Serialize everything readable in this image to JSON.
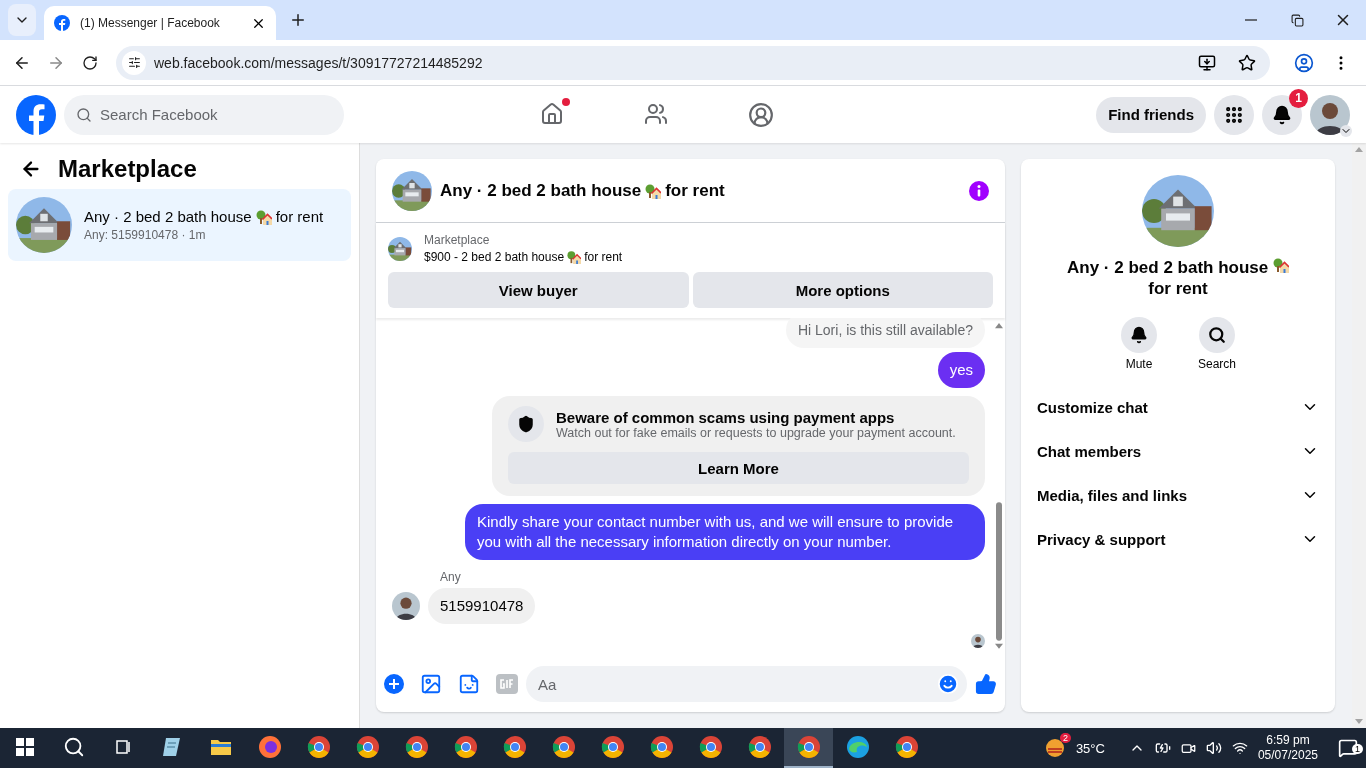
{
  "browser": {
    "tab_title": "(1) Messenger | Facebook",
    "url": "web.facebook.com/messages/t/30917727214485292"
  },
  "header": {
    "search_placeholder": "Search Facebook",
    "home_unread": true,
    "find_friends": "Find friends",
    "notification_count": "1"
  },
  "sidebar": {
    "title": "Marketplace",
    "conversations": [
      {
        "title_before": "Any · 2 bed 2 bath house",
        "title_after": "for rent",
        "preview": "Any: 5159910478 · 1m",
        "selected": true
      }
    ]
  },
  "chat": {
    "title_before": "Any · 2 bed 2 bath house",
    "title_after": "for rent",
    "listing": {
      "label": "Marketplace",
      "text_before": "$900 - 2 bed 2 bath house",
      "text_after": "for rent"
    },
    "actions": [
      "View buyer",
      "More options"
    ],
    "messages": [
      {
        "kind": "outgoing_auto",
        "text": "Hi Lori, is this still available?"
      },
      {
        "kind": "outgoing",
        "text": "yes",
        "color": "#6b2ff2"
      },
      {
        "kind": "notice",
        "title": "Beware of common scams using payment apps",
        "text": "Watch out for fake emails or requests to upgrade your payment account.",
        "button": "Learn More"
      },
      {
        "kind": "outgoing",
        "text": "Kindly share your contact number with us, and we will ensure to provide you with all the necessary information directly on your number.",
        "color": "#4a3ff5"
      },
      {
        "kind": "incoming",
        "sender": "Any",
        "text": "5159910478"
      }
    ],
    "composer": {
      "placeholder": "Aa"
    }
  },
  "info": {
    "title_before": "Any · 2 bed 2 bath house",
    "title_after": "for rent",
    "actions": [
      {
        "kind": "mute",
        "label": "Mute"
      },
      {
        "kind": "search",
        "label": "Search"
      }
    ],
    "sections": [
      {
        "label": "Customize chat",
        "expanded": false
      },
      {
        "label": "Chat members",
        "expanded": false
      },
      {
        "label": "Media, files and links",
        "expanded": false
      },
      {
        "label": "Privacy & support",
        "expanded": false
      }
    ]
  },
  "taskbar": {
    "apps": [
      {
        "kind": "notepad",
        "selected": false
      },
      {
        "kind": "folder",
        "selected": false
      },
      {
        "kind": "firefox",
        "selected": false
      },
      {
        "kind": "chrome",
        "selected": false
      },
      {
        "kind": "chrome",
        "selected": false
      },
      {
        "kind": "chrome",
        "selected": false
      },
      {
        "kind": "chrome",
        "selected": false
      },
      {
        "kind": "chrome",
        "selected": false
      },
      {
        "kind": "chrome",
        "selected": false
      },
      {
        "kind": "chrome",
        "selected": false
      },
      {
        "kind": "chrome",
        "selected": false
      },
      {
        "kind": "chrome",
        "selected": false
      },
      {
        "kind": "chrome",
        "selected": false
      },
      {
        "kind": "chrome",
        "selected": true
      },
      {
        "kind": "edge",
        "selected": false
      },
      {
        "kind": "chrome",
        "selected": false
      }
    ],
    "weather_badge": "2",
    "temperature": "35°C",
    "time": "6:59 pm",
    "date": "05/07/2025",
    "notification_count": "1"
  }
}
